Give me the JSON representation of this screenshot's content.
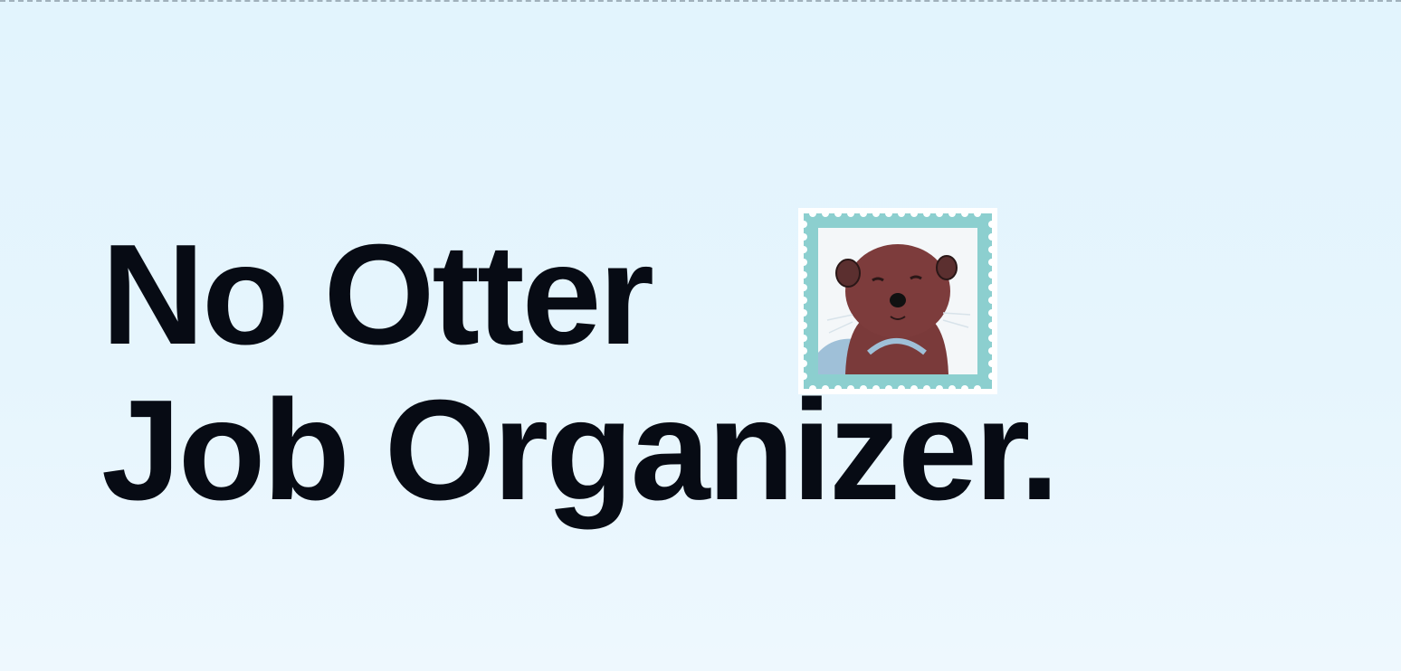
{
  "hero": {
    "line1": "No Otter",
    "line2": "Job Organizer."
  },
  "stamp": {
    "icon": "otter-stamp-icon",
    "colors": {
      "border": "#8ccfcf",
      "paper": "#f4f7f9",
      "fur": "#7a3a3a"
    }
  },
  "colors": {
    "background": "#e3f4fd",
    "text": "#070b14"
  }
}
